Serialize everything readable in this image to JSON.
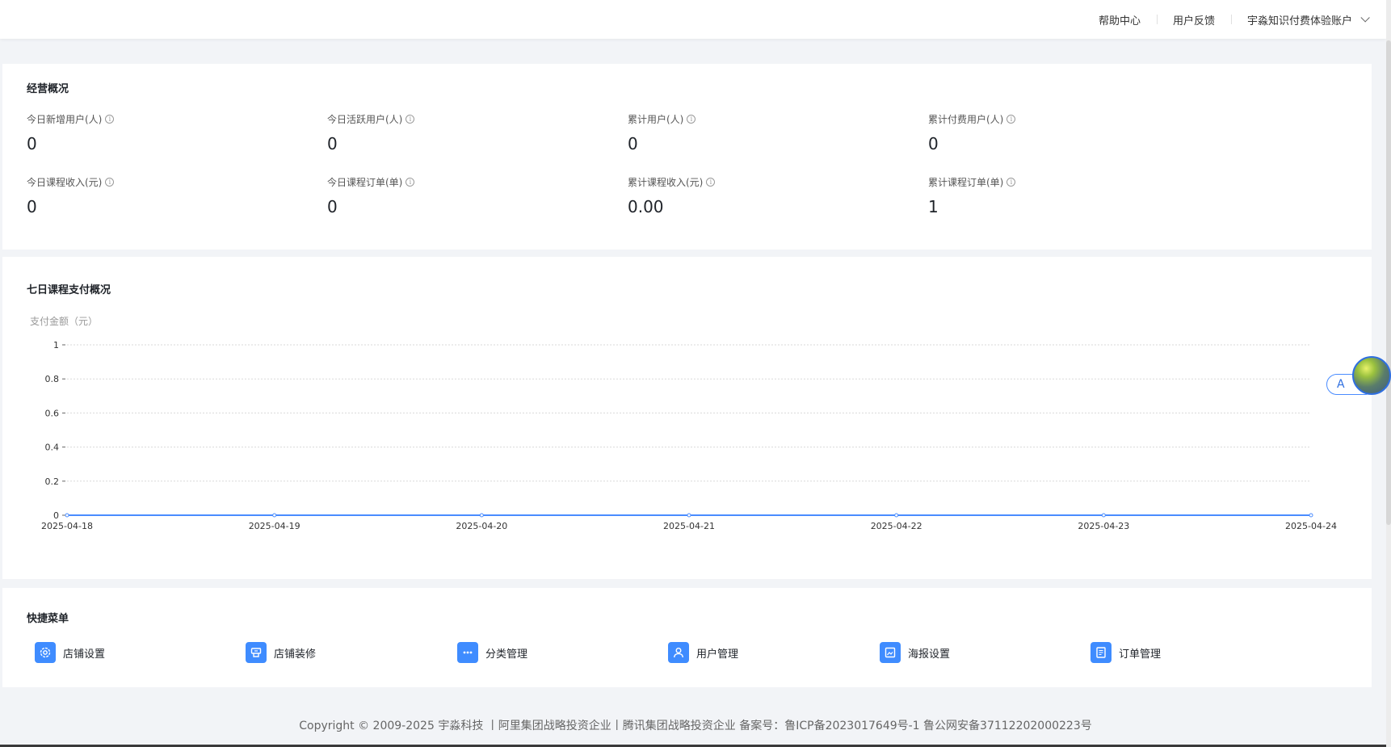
{
  "topbar": {
    "help": "帮助中心",
    "feedback": "用户反馈",
    "account": "宇淼知识付费体验账户"
  },
  "overview": {
    "title": "经营概况",
    "stats": [
      {
        "label": "今日新增用户(人)",
        "value": "0"
      },
      {
        "label": "今日活跃用户(人)",
        "value": "0"
      },
      {
        "label": "累计用户(人)",
        "value": "0"
      },
      {
        "label": "累计付费用户(人)",
        "value": "0"
      },
      {
        "label": "今日课程收入(元)",
        "value": "0"
      },
      {
        "label": "今日课程订单(单)",
        "value": "0"
      },
      {
        "label": "累计课程收入(元)",
        "value": "0.00"
      },
      {
        "label": "累计课程订单(单)",
        "value": "1"
      }
    ]
  },
  "chart": {
    "title": "七日课程支付概况"
  },
  "chart_data": {
    "type": "line",
    "ylabel": "支付金额（元）",
    "x": [
      "2025-04-18",
      "2025-04-19",
      "2025-04-20",
      "2025-04-21",
      "2025-04-22",
      "2025-04-23",
      "2025-04-24"
    ],
    "series": [
      {
        "values": [
          0,
          0,
          0,
          0,
          0,
          0,
          0
        ]
      }
    ],
    "ylim": [
      0,
      1
    ],
    "yticks": [
      "0",
      "0.2",
      "0.4",
      "0.6",
      "0.8",
      "1"
    ],
    "grid": true,
    "line_color": "#4a8cff"
  },
  "quick_menu": {
    "title": "快捷菜单",
    "items": [
      {
        "label": "店铺设置",
        "icon": "gear-icon"
      },
      {
        "label": "店铺装修",
        "icon": "decoration-icon"
      },
      {
        "label": "分类管理",
        "icon": "more-dots-icon"
      },
      {
        "label": "用户管理",
        "icon": "user-icon"
      },
      {
        "label": "海报设置",
        "icon": "poster-icon"
      },
      {
        "label": "订单管理",
        "icon": "document-icon"
      }
    ]
  },
  "footer": {
    "text": "Copyright © 2009-2025 宇淼科技 丨阿里集团战略投资企业丨腾讯集团战略投资企业 备案号：鲁ICP备2023017649号-1 鲁公网安备37112202000223号"
  },
  "float_widget": {
    "label": "A"
  },
  "colors": {
    "accent": "#3f8cff",
    "background": "#f2f4f7"
  }
}
